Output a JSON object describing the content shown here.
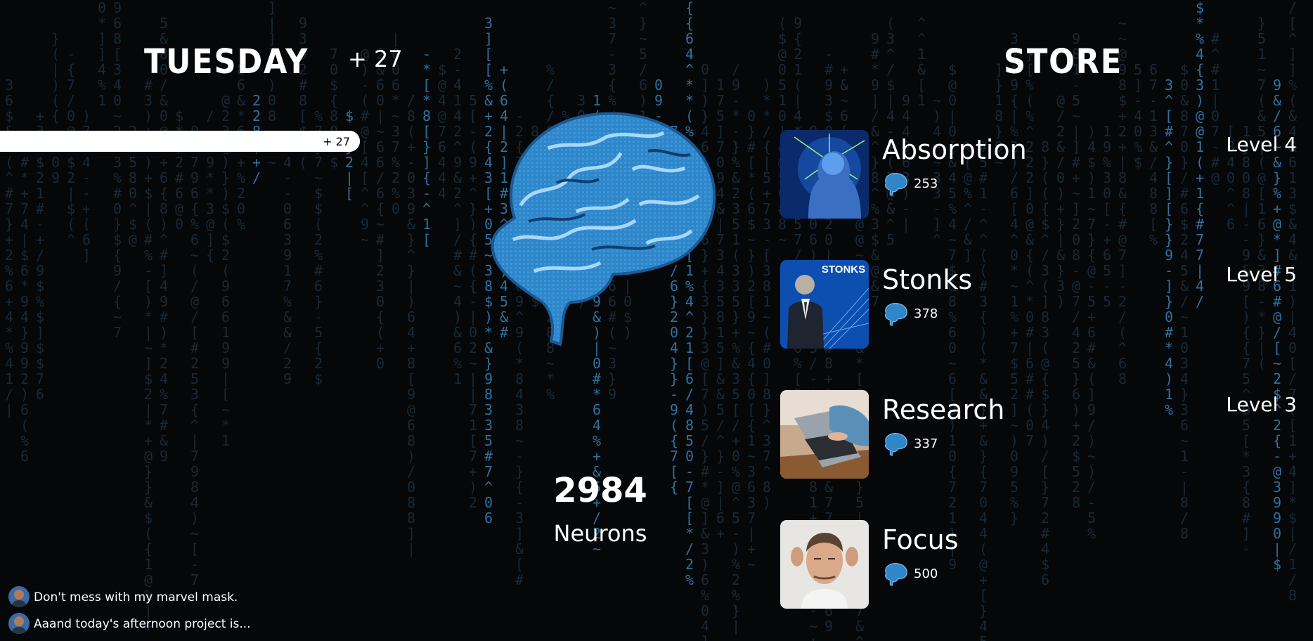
{
  "header": {
    "day": "TUESDAY",
    "day_bonus": "+ 27"
  },
  "progress": {
    "label": "+ 27",
    "fraction": 1.0
  },
  "counter": {
    "value": "2984",
    "label": "Neurons"
  },
  "store": {
    "title": "STORE",
    "items": [
      {
        "name": "Absorption",
        "cost": "253",
        "level": "Level 4",
        "thumb": "head-with-rays-image"
      },
      {
        "name": "Stonks",
        "cost": "378",
        "level": "Level 5",
        "thumb": "stonks-meme-image",
        "thumb_text": "STONKS"
      },
      {
        "name": "Research",
        "cost": "337",
        "level": "Level 3",
        "thumb": "laptop-typing-image"
      },
      {
        "name": "Focus",
        "cost": "500",
        "level": "",
        "thumb": "man-concentrating-image"
      }
    ]
  },
  "chat": [
    {
      "text": "Don't mess with my marvel mask."
    },
    {
      "text": "Aaand today's afternoon project is..."
    }
  ],
  "colors": {
    "background": "#050708",
    "brain_blue": "#2f86c9",
    "matrix_blue": "#2b8fd0"
  }
}
